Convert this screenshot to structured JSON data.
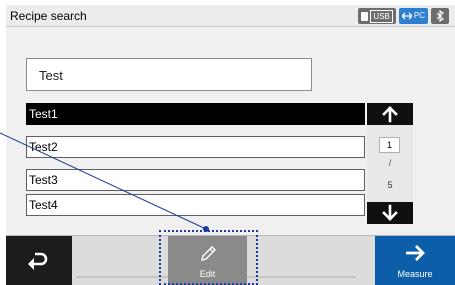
{
  "header": {
    "title": "Recipe search",
    "usb_label": "USB",
    "pc_label": "PC",
    "bluetooth_icon": "bluetooth-icon"
  },
  "search": {
    "value": "Test"
  },
  "recipes": [
    {
      "label": "Test1",
      "selected": true
    },
    {
      "label": "Test2",
      "selected": false
    },
    {
      "label": "Test3",
      "selected": false
    },
    {
      "label": "Test4",
      "selected": false
    }
  ],
  "pager": {
    "current": "1",
    "separator": "/",
    "total": "5"
  },
  "toolbar": {
    "back_icon": "return-arrow-icon",
    "edit_label": "Edit",
    "edit_icon": "pencil-icon",
    "measure_label": "Measure",
    "measure_icon": "right-arrow-icon"
  },
  "colors": {
    "accent_blue": "#0d5ea8",
    "selected_row": "#000000",
    "callout": "#1b3b9a"
  }
}
